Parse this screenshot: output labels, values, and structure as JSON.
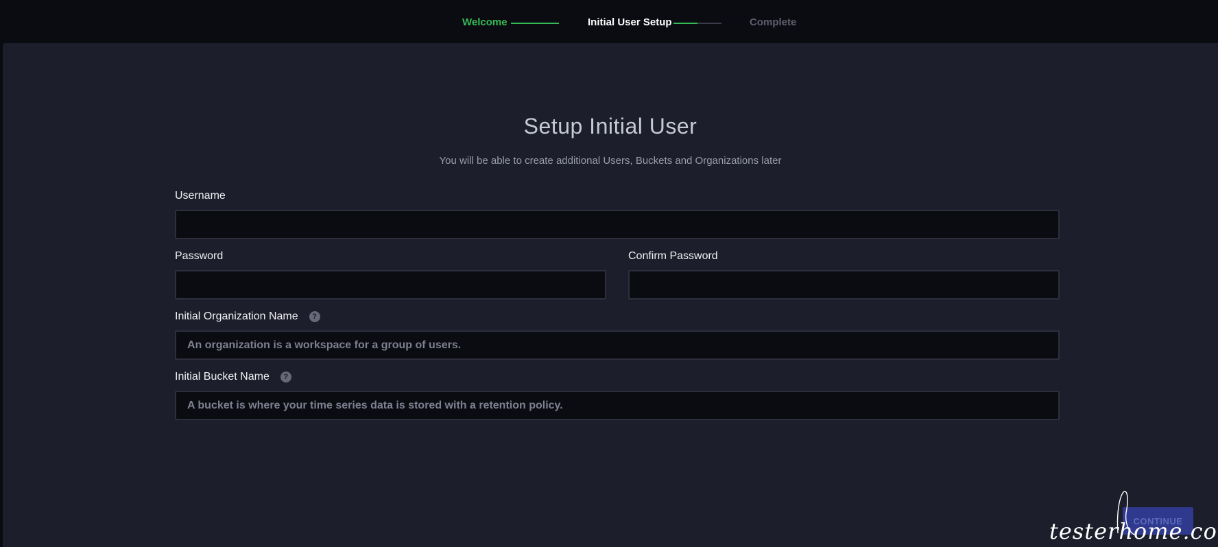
{
  "stepper": {
    "steps": [
      {
        "label": "Welcome",
        "state": "done"
      },
      {
        "label": "Initial User Setup",
        "state": "current"
      },
      {
        "label": "Complete",
        "state": "pending"
      }
    ],
    "progress_to_complete": 0.5
  },
  "form": {
    "title": "Setup Initial User",
    "subtitle": "You will be able to create additional Users, Buckets and Organizations later",
    "username": {
      "label": "Username",
      "value": "",
      "placeholder": ""
    },
    "password": {
      "label": "Password",
      "value": "",
      "placeholder": ""
    },
    "confirm_password": {
      "label": "Confirm Password",
      "value": "",
      "placeholder": ""
    },
    "org": {
      "label": "Initial Organization Name",
      "value": "",
      "placeholder": "An organization is a workspace for a group of users."
    },
    "bucket": {
      "label": "Initial Bucket Name",
      "value": "",
      "placeholder": "A bucket is where your time series data is stored with a retention policy."
    },
    "help_glyph": "?"
  },
  "actions": {
    "continue_label": "CONTINUE"
  },
  "watermark": "testerhome.com",
  "colors": {
    "accent_green": "#34bb55",
    "panel_bg": "#1c1e2b",
    "input_bg": "#0b0c12",
    "button_bg": "#2f3a8f"
  }
}
